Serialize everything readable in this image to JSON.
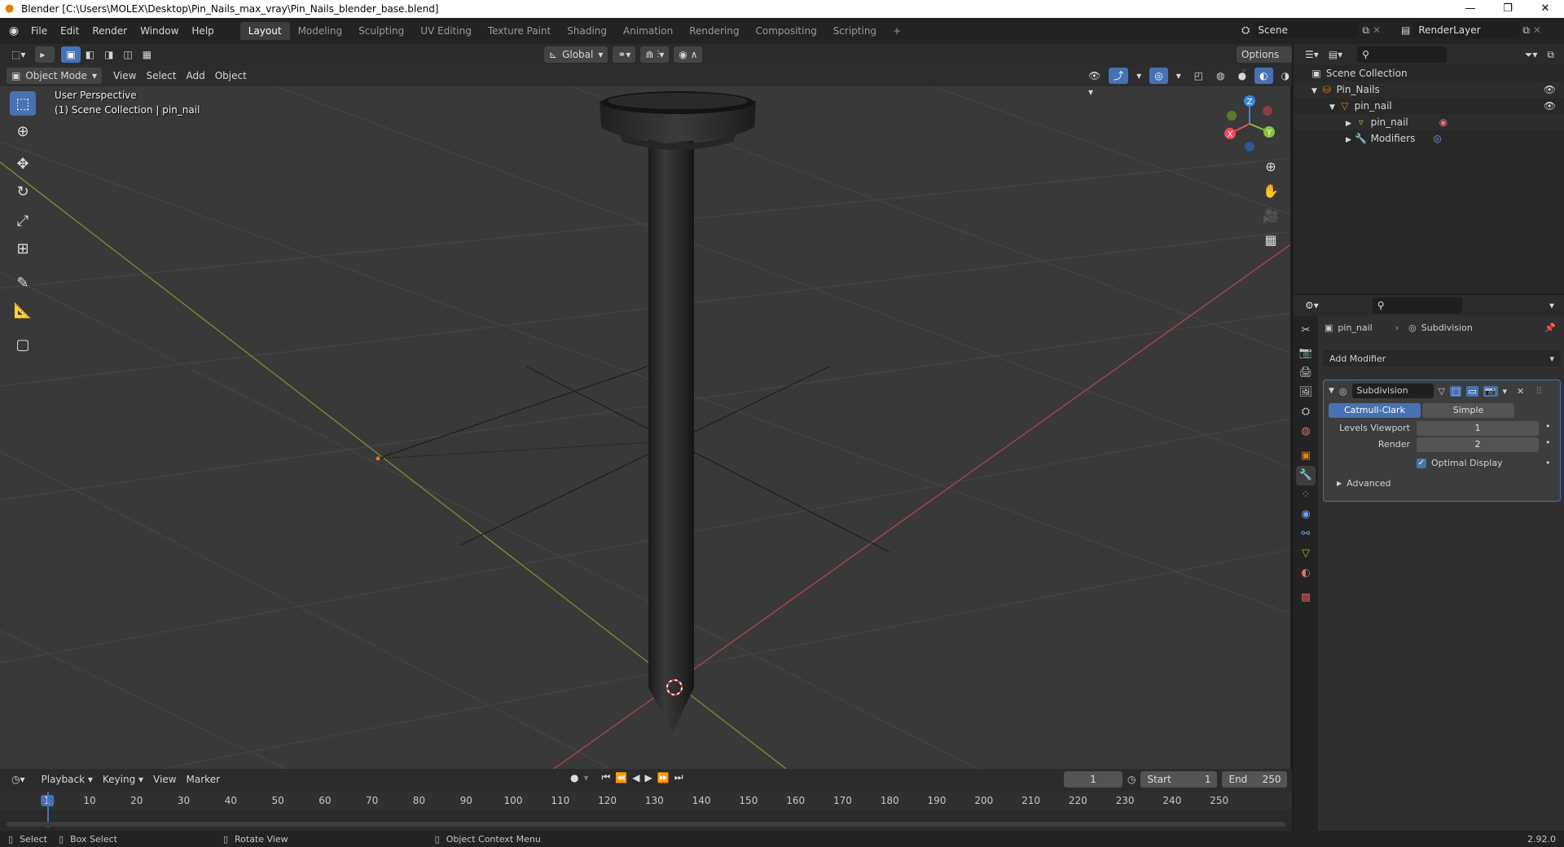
{
  "window": {
    "title": "Blender [C:\\Users\\MOLEX\\Desktop\\Pin_Nails_max_vray\\Pin_Nails_blender_base.blend]",
    "controls": [
      "—",
      "❐",
      "✕"
    ]
  },
  "menu": {
    "items": [
      "File",
      "Edit",
      "Render",
      "Window",
      "Help"
    ]
  },
  "workspaces": {
    "tabs": [
      "Layout",
      "Modeling",
      "Sculpting",
      "UV Editing",
      "Texture Paint",
      "Shading",
      "Animation",
      "Rendering",
      "Compositing",
      "Scripting"
    ],
    "active": "Layout",
    "add": "+"
  },
  "scene": {
    "name": "Scene",
    "render_layer": "RenderLayer"
  },
  "viewport": {
    "mode": "Object Mode",
    "menus": [
      "View",
      "Select",
      "Add",
      "Object"
    ],
    "orientation": "Global",
    "options": "Options",
    "perspective": "User Perspective",
    "collection_info": "(1) Scene Collection | pin_nail",
    "gizmo": {
      "z": "Z",
      "y": "Y",
      "x": "X"
    }
  },
  "colors": {
    "accent": "#4772b3",
    "x_axis": "#ee4a5b",
    "y_axis": "#8bc23f",
    "z_axis": "#3b86e3",
    "orange": "#e87d0d",
    "viewport_bg": "#393939"
  },
  "timeline": {
    "menus": [
      "Playback",
      "Keying",
      "View",
      "Marker"
    ],
    "current_frame": "1",
    "start_label": "Start",
    "start": "1",
    "end_label": "End",
    "end": "250",
    "ticks": [
      "1",
      "10",
      "20",
      "30",
      "40",
      "50",
      "60",
      "70",
      "80",
      "90",
      "100",
      "110",
      "120",
      "130",
      "140",
      "150",
      "160",
      "170",
      "180",
      "190",
      "200",
      "210",
      "220",
      "230",
      "240",
      "250"
    ]
  },
  "statusbar": {
    "select": "Select",
    "box_select": "Box Select",
    "rotate_view": "Rotate View",
    "context_menu": "Object Context Menu",
    "version": "2.92.0"
  },
  "outliner": {
    "root": "Scene Collection",
    "collection": "Pin_Nails",
    "object": "pin_nail",
    "mesh": "pin_nail",
    "modifiers": "Modifiers"
  },
  "properties": {
    "object": "pin_nail",
    "modifier_name": "Subdivision",
    "add_modifier": "Add Modifier",
    "type_catmull": "Catmull-Clark",
    "type_simple": "Simple",
    "levels_viewport_label": "Levels Viewport",
    "levels_viewport": "1",
    "render_label": "Render",
    "render": "2",
    "optimal_display": "Optimal Display",
    "advanced": "Advanced"
  }
}
